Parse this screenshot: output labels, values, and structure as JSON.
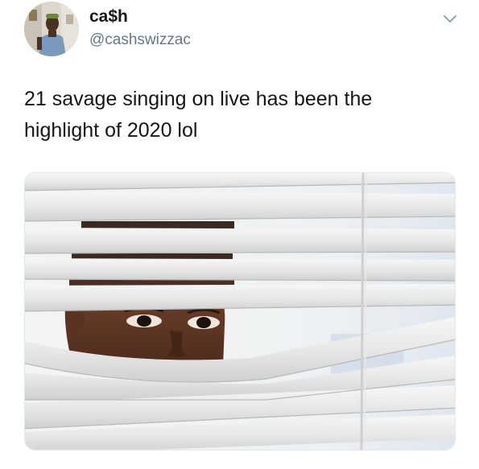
{
  "tweet": {
    "display_name": "ca$h",
    "handle": "@cashswizzac",
    "text": "21 savage singing on live has been the\nhighlight of 2020 lol"
  },
  "icons": {
    "menu": "chevron-down-icon"
  },
  "colors": {
    "text_primary": "#14171a",
    "text_secondary": "#657786",
    "chevron": "#8899a6",
    "media_border": "#e1e8ed"
  }
}
